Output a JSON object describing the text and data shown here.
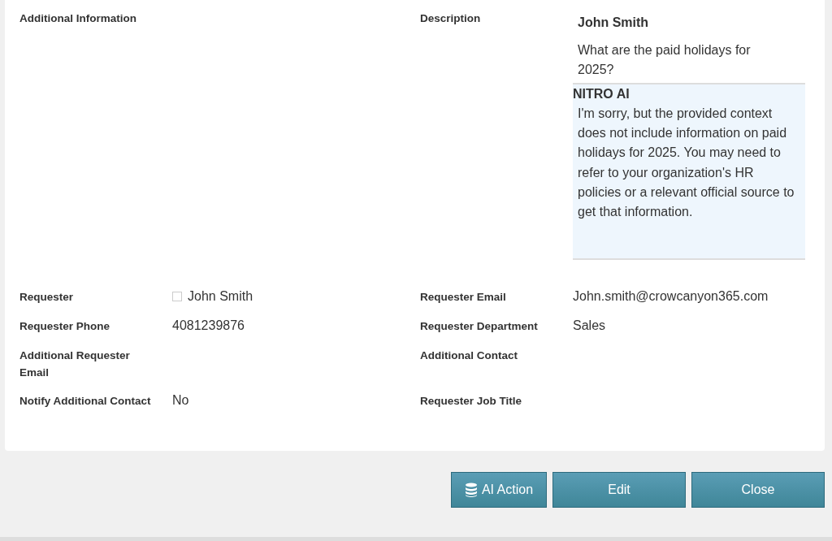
{
  "rows": [
    {
      "cells": [
        {
          "label": "Additional Information",
          "kind": "text"
        },
        {
          "label": "Description",
          "kind": "conversation",
          "conversation": {
            "author": "John Smith",
            "question": "What are the paid holidays for 2025?",
            "reply_author": "NITRO AI",
            "reply": "I'm sorry, but the provided context does not include information on paid holidays for 2025. You may need to refer to your organization's HR policies or a relevant official source to get that information."
          }
        }
      ]
    },
    {
      "cells": [
        {
          "label": "Requester",
          "kind": "person",
          "value": "John Smith"
        },
        {
          "label": "Requester Email",
          "kind": "text",
          "value": "John.smith@crowcanyon365.com"
        }
      ]
    },
    {
      "cells": [
        {
          "label": "Requester Phone",
          "kind": "text",
          "value": "4081239876"
        },
        {
          "label": "Requester Department",
          "kind": "text",
          "value": "Sales"
        }
      ]
    },
    {
      "cells": [
        {
          "label": "Additional Requester Email",
          "kind": "text"
        },
        {
          "label": "Additional Contact",
          "kind": "text"
        }
      ]
    },
    {
      "cells": [
        {
          "label": "Notify Additional Contact",
          "kind": "text",
          "value": "No"
        },
        {
          "label": "Requester Job Title",
          "kind": "text"
        }
      ]
    }
  ],
  "buttons": [
    {
      "label": "AI Action",
      "kind": "database"
    },
    {
      "label": "Edit",
      "kind": "plain"
    },
    {
      "label": "Close",
      "kind": "plain"
    }
  ]
}
